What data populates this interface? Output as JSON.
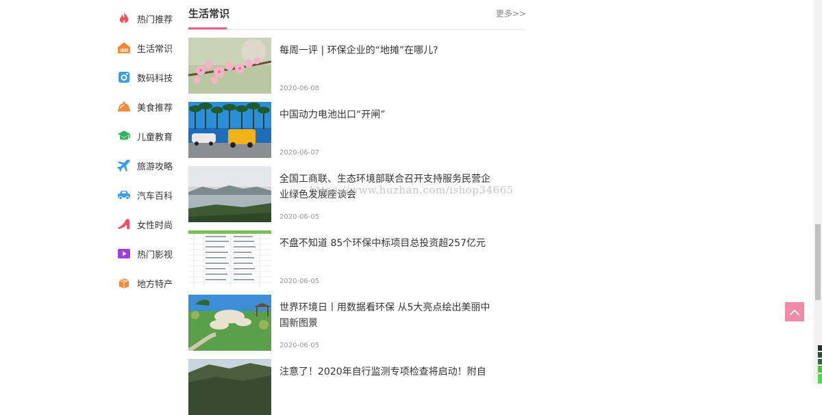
{
  "sidebar": {
    "items": [
      {
        "label": "热门推荐",
        "icon": "flame-icon",
        "color": "#f0505a"
      },
      {
        "label": "生活常识",
        "icon": "house-icon",
        "color": "#f28a3a"
      },
      {
        "label": "数码科技",
        "icon": "camera-icon",
        "color": "#3a9ee8"
      },
      {
        "label": "美食推荐",
        "icon": "food-cover-icon",
        "color": "#f28a3a"
      },
      {
        "label": "儿童教育",
        "icon": "graduation-cap-icon",
        "color": "#2fb55b"
      },
      {
        "label": "旅游攻略",
        "icon": "airplane-icon",
        "color": "#3a9ee8"
      },
      {
        "label": "汽车百科",
        "icon": "car-icon",
        "color": "#3a9ee8"
      },
      {
        "label": "女性时尚",
        "icon": "high-heel-icon",
        "color": "#f0506e"
      },
      {
        "label": "热门影视",
        "icon": "video-play-icon",
        "color": "#a03fd8"
      },
      {
        "label": "地方特产",
        "icon": "gift-box-icon",
        "color": "#f28a3a"
      }
    ]
  },
  "section": {
    "title": "生活常识",
    "more": "更多>>",
    "accent": "#e85d8d"
  },
  "articles": [
    {
      "title": "每周一评 | 环保企业的“地摊”在哪儿?",
      "date": "2020-06-08"
    },
    {
      "title": "中国动力电池出口“开闸”",
      "date": "2020-06-07"
    },
    {
      "title": "全国工商联、生态环境部联合召开支持服务民营企业绿色发展座谈会",
      "date": "2020-06-05"
    },
    {
      "title": "不盘不知道 85个环保中标项目总投资超257亿元",
      "date": "2020-06-05"
    },
    {
      "title": "世界环境日丨用数据看环保 从5大亮点绘出美丽中国新图景",
      "date": "2020-06-05"
    },
    {
      "title": "注意了！2020年自行监测专项检查将启动！附自",
      "date": ""
    }
  ],
  "watermark": "https://www.huzhan.com/ishop34665",
  "back_to_top": {
    "icon": "chevron-up-icon",
    "color": "#f08aa9"
  }
}
